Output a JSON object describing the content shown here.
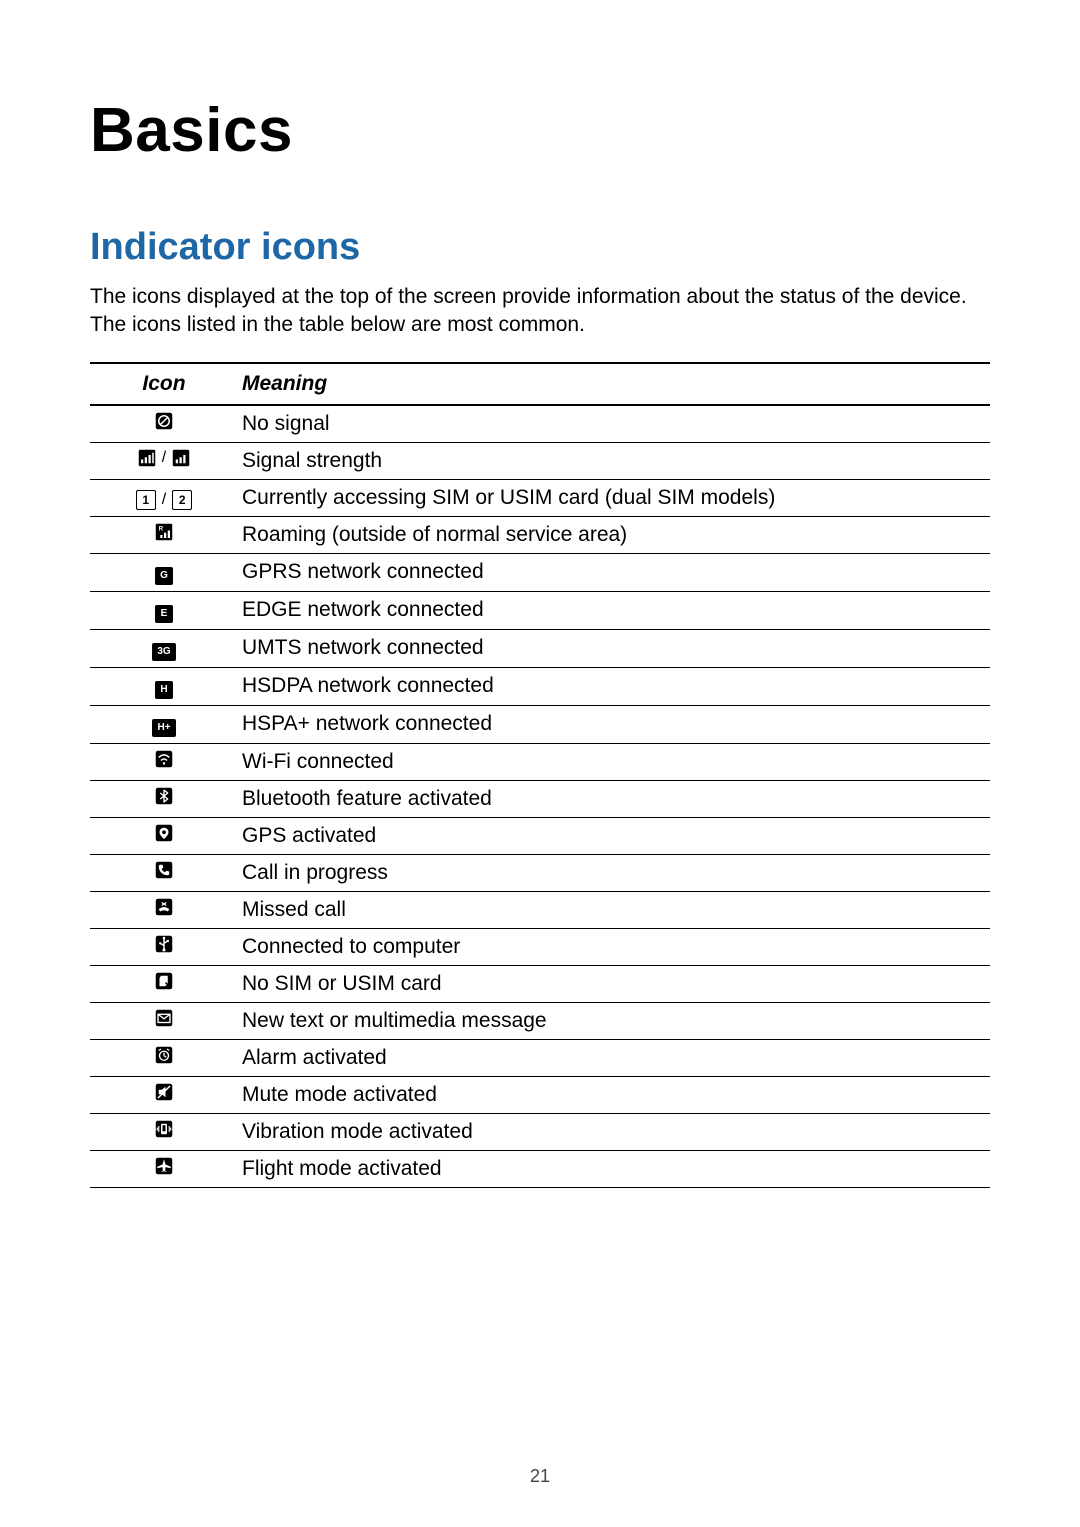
{
  "page": {
    "title": "Basics",
    "section_heading": "Indicator icons",
    "intro": "The icons displayed at the top of the screen provide information about the status of the device. The icons listed in the table below are most common.",
    "page_number": "21"
  },
  "table": {
    "header_icon": "Icon",
    "header_meaning": "Meaning",
    "rows": [
      {
        "icon_key": "no-signal",
        "meaning": "No signal"
      },
      {
        "icon_key": "signal-strength",
        "meaning": "Signal strength"
      },
      {
        "icon_key": "sim-access",
        "meaning": "Currently accessing SIM or USIM card (dual SIM models)"
      },
      {
        "icon_key": "roaming",
        "meaning": "Roaming (outside of normal service area)"
      },
      {
        "icon_key": "gprs",
        "meaning": "GPRS network connected"
      },
      {
        "icon_key": "edge",
        "meaning": "EDGE network connected"
      },
      {
        "icon_key": "umts",
        "meaning": "UMTS network connected"
      },
      {
        "icon_key": "hsdpa",
        "meaning": "HSDPA network connected"
      },
      {
        "icon_key": "hspaplus",
        "meaning": "HSPA+ network connected"
      },
      {
        "icon_key": "wifi",
        "meaning": "Wi-Fi connected"
      },
      {
        "icon_key": "bluetooth",
        "meaning": "Bluetooth feature activated"
      },
      {
        "icon_key": "gps",
        "meaning": "GPS activated"
      },
      {
        "icon_key": "call",
        "meaning": "Call in progress"
      },
      {
        "icon_key": "missed-call",
        "meaning": "Missed call"
      },
      {
        "icon_key": "usb",
        "meaning": "Connected to computer"
      },
      {
        "icon_key": "no-sim",
        "meaning": "No SIM or USIM card"
      },
      {
        "icon_key": "message",
        "meaning": "New text or multimedia message"
      },
      {
        "icon_key": "alarm",
        "meaning": "Alarm activated"
      },
      {
        "icon_key": "mute",
        "meaning": "Mute mode activated"
      },
      {
        "icon_key": "vibrate",
        "meaning": "Vibration mode activated"
      },
      {
        "icon_key": "flight",
        "meaning": "Flight mode activated"
      }
    ]
  }
}
